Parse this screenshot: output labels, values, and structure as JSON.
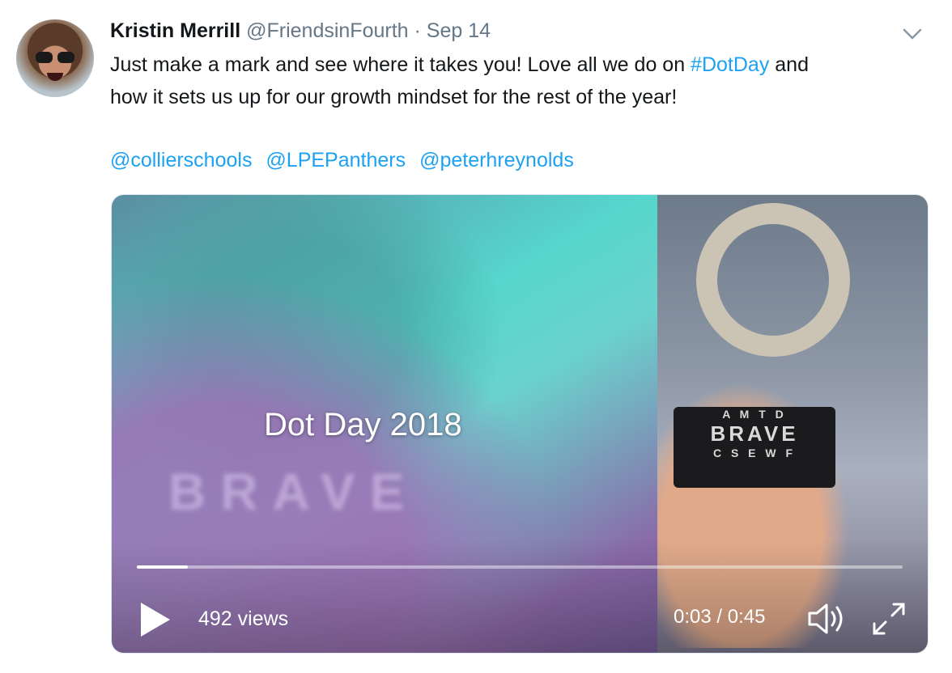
{
  "tweet": {
    "author_name": "Kristin Merrill",
    "author_handle": "@FriendsinFourth",
    "separator": "·",
    "date": "Sep 14",
    "text_before_hashtag": "Just make a mark and see where it takes you! Love all we do on ",
    "hashtag": "#DotDay",
    "text_after_hashtag": " and",
    "text_line2": "how it sets us up for our growth mindset for the rest of the year!",
    "mentions": [
      "@collierschools",
      "@LPEPanthers",
      "@peterhreynolds"
    ]
  },
  "video": {
    "title_overlay": "Dot Day 2018",
    "lock_rows": [
      "A M T D",
      "BRAVE",
      "C S E W F"
    ],
    "views": "492 views",
    "time": "0:03 / 0:45",
    "progress": 0.067
  },
  "icons": {
    "chevron": "chevron-down-icon",
    "play": "play-icon",
    "volume": "volume-icon",
    "fullscreen": "fullscreen-icon"
  },
  "colors": {
    "link": "#1da1f2",
    "secondary_text": "#657786",
    "primary_text": "#14171a"
  }
}
